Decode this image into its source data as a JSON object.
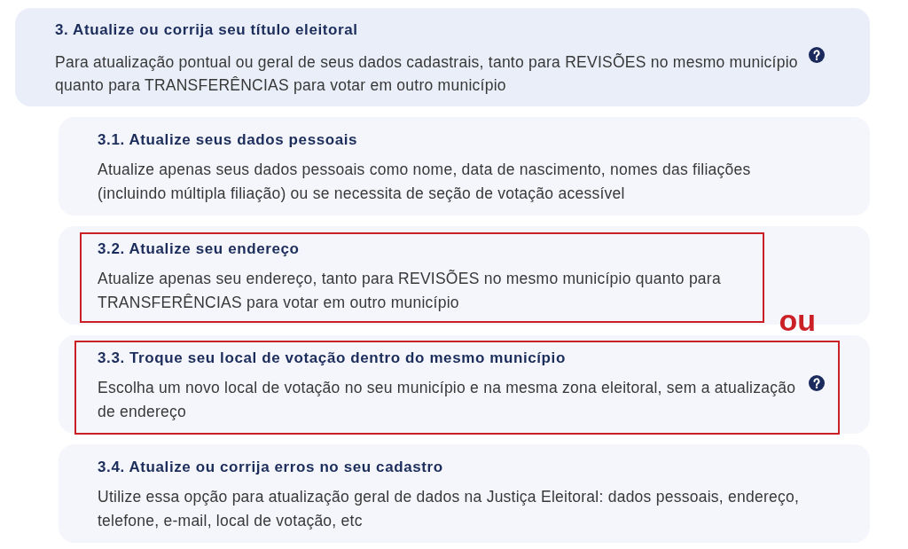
{
  "section": {
    "title": "3. Atualize ou corrija seu título eleitoral",
    "description": "Para atualização pontual ou geral de seus dados cadastrais, tanto para REVISÕES no mesmo município quanto para TRANSFERÊNCIAS para votar em outro município",
    "help_icon": true
  },
  "options": [
    {
      "title": "3.1. Atualize seus dados pessoais",
      "description": "Atualize apenas seus dados pessoais como nome, data de nascimento, nomes das filiações (incluindo múltipla filiação) ou se necessita de seção de votação acessível",
      "help_icon": false,
      "highlighted": false
    },
    {
      "title": "3.2. Atualize seu endereço",
      "description": "Atualize apenas seu endereço, tanto para REVISÕES no mesmo município quanto para TRANSFERÊNCIAS para votar em outro município",
      "help_icon": false,
      "highlighted": true,
      "note": "ou"
    },
    {
      "title": "3.3. Troque seu local de votação dentro do mesmo município",
      "description": "Escolha um novo local de votação no seu município e na mesma zona eleitoral, sem a atualização de endereço",
      "help_icon": true,
      "highlighted": true
    },
    {
      "title": "3.4. Atualize ou corrija erros no seu cadastro",
      "description": "Utilize essa opção para atualização geral de dados na Justiça Eleitoral: dados pessoais, endereço, telefone, e-mail, local de votação, etc",
      "help_icon": false,
      "highlighted": false
    }
  ]
}
